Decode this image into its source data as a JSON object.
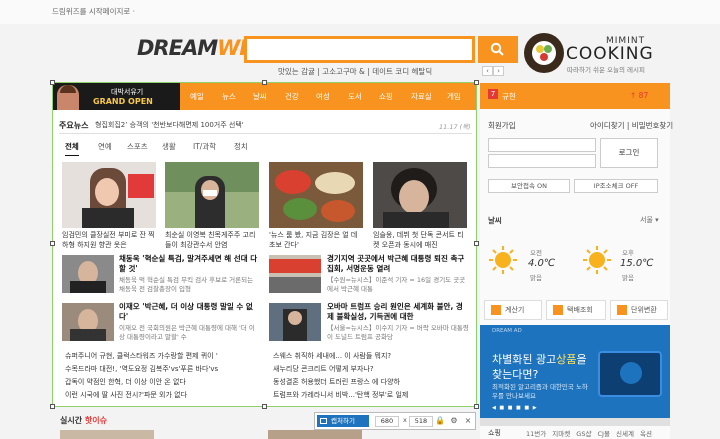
{
  "top_link": "드림위즈를 시작페이지로 ·",
  "logo": {
    "part1": "DREAM",
    "part2": "WIZ"
  },
  "search": {
    "value": "",
    "keywords": "맛있는 감귤 | 고소고구마 & | 데이트 코디 헤탈딕"
  },
  "cooking_banner": {
    "mimint": "MIMINT",
    "cooking": "COOKING",
    "tagline": "따라하기 쉬운 오늘의 레시피"
  },
  "ranking_bar": {
    "badge": "7",
    "left": "규현",
    "right": "↑ 87"
  },
  "login": {
    "title": "회원가입",
    "links": "아이디찾기 | 비밀번호찾기",
    "button": "로그인",
    "secure": "보안접속 ON",
    "ip_secure": "IP조소체크 OFF"
  },
  "weather": {
    "title": "날씨",
    "city": "서울 ▾",
    "am_label": "오전",
    "am_temp": "4.0℃",
    "am_desc": "맑음",
    "pm_label": "오후",
    "pm_temp": "15.0℃",
    "pm_desc": "맑음"
  },
  "services": [
    "계산기",
    "택배조회",
    "단위변환"
  ],
  "ad": {
    "tag": "DREAM AD",
    "line1_pre": "차별화된 광고",
    "line1_hl": "상품",
    "line1_post": "을",
    "line2": "찾는다면?",
    "line3": "최적화된 알고리즘과 대한민국 노하우를 만나보세요",
    "nav": "◀ ■ ■ ■ ■ ▶"
  },
  "shop": {
    "title": "쇼핑",
    "links": "11번가 지마켓 GS샵 CJ몰 신세계 옥션"
  },
  "bottom_left": {
    "title": "실시간",
    "highlight": "핫이슈"
  },
  "capture": {
    "banner_ad": {
      "line1": "대박서유기",
      "line2": "GRAND OPEN"
    },
    "nav": [
      "예일",
      "뉴스",
      "날씨",
      "건강",
      "여성",
      "도서",
      "쇼핑",
      "자료실",
      "게임"
    ],
    "section_title": "주요뉴스",
    "ticker": "형집회집2’ 승객의 '천반보다해면제 100거주 선택'",
    "date": "11.17 (목)",
    "tabs": [
      "전체",
      "연예",
      "스포츠",
      "생활",
      "IT/과학",
      "정치"
    ],
    "cards": [
      {
        "caption": "임검민의 클장실전 부미로 잔 찍하형 하지원 향관 옷은"
      },
      {
        "caption": "최순실 이영복 친목게주주 고리들이 최강관수서 안염"
      },
      {
        "caption": "'뉴스 룸 봤, 지금 김장은 얼 데 초보 간다'"
      },
      {
        "caption": "임슬옹, 데뷔 첫 단독 콘서트 티켓 오픈과 동시에 매진"
      }
    ],
    "mid_news": [
      {
        "title": "채동욱 '혁순실 특검, 말겨주세면 해 선대 다할 것'",
        "desc": "채동욱 먹 혁순실 특검 무킥 검사 후보로 거론되는 채동욱 전 검찰총장이 입형"
      },
      {
        "title": "경기지역 곳곳에서 박근혜 대통령 퇴진 촉구 집회, 서명운동 열려",
        "desc": "【수원=뉴시스】이준석 기자 = 16일 경기도 곳곳에서 박근혜 대통"
      },
      {
        "title": "이재오 '박근혜, 더 이상 대통령 말일 수 없다'",
        "desc": "이재오 전 국회의원은 박근혜 대통령에 대해 '더 이상 대통령이라고 말할' 수"
      },
      {
        "title": "오바마 트럼프 승리 원인은 세계화 불안, 경제 불확실성, 기득권에 대한",
        "desc": "【서울=뉴시스】이수지 기자 = 버락 오바마 대통령이 도널드 트럼프 공화당"
      }
    ],
    "list_left": [
      "슈퍼주니어 규현, 클럭스타워즈 가수랑할 편제 퀴이 '",
      "수목드라마 대전!, '역도요정 김복주'vs'푸른 바다'vs",
      "갑독이 약점인 한혁, 더 이상 이안 온 없다",
      "이런 시국에 딸 사진 전시?'파문 외가 없다"
    ],
    "list_right": [
      "스웨스 취직하 세내에... 이 사람들 뭐지?",
      "새누리당 콘크리트 어떻게 부자나?",
      "동성결혼 허용했더 트러린 프랑스 에 다양하",
      "트럼프와 가레라니서 비박...'탄핵 정부'로 일제"
    ]
  },
  "toolbar": {
    "capture_label": "캡처하기",
    "width": "680",
    "x": "x",
    "height": "518"
  }
}
